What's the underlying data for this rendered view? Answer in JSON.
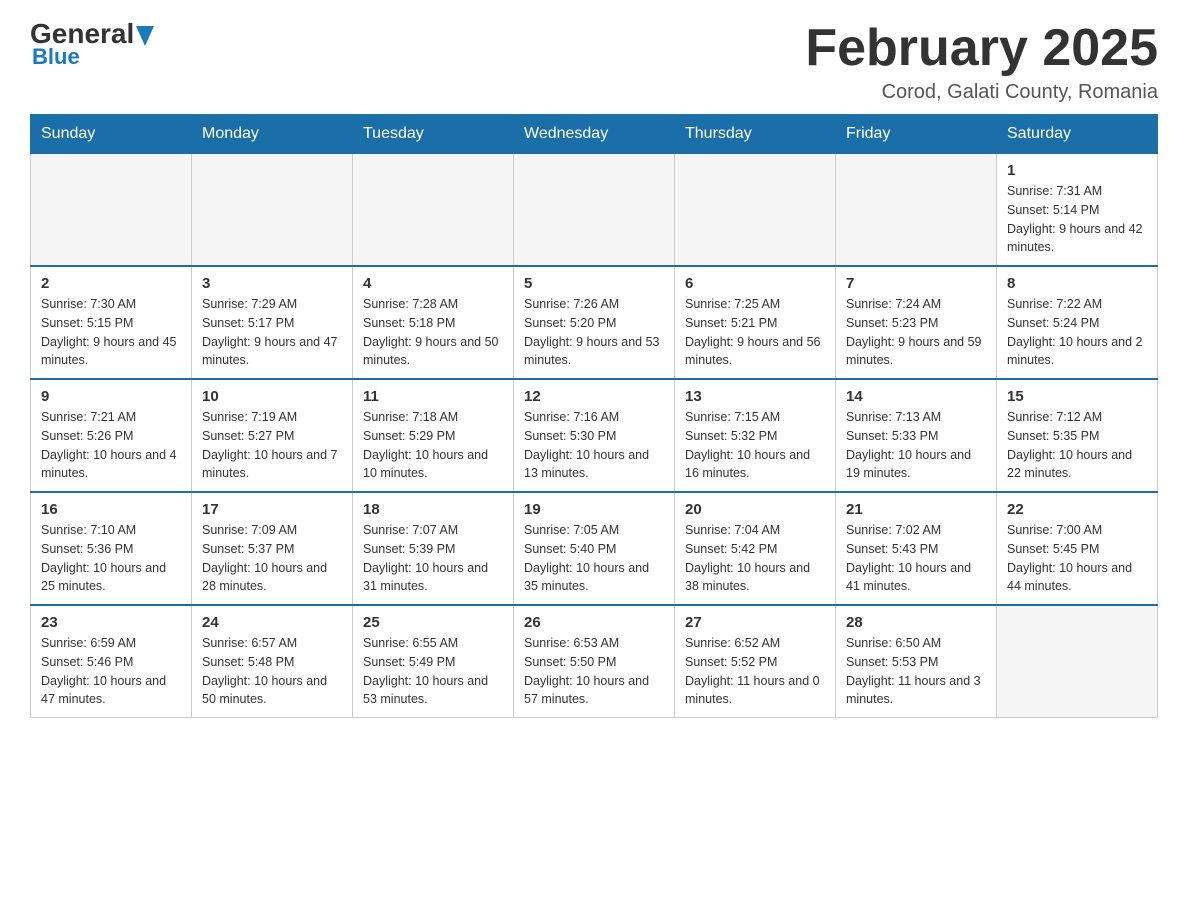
{
  "header": {
    "logo_general": "General",
    "logo_blue": "Blue",
    "month_title": "February 2025",
    "location": "Corod, Galati County, Romania"
  },
  "days_of_week": [
    "Sunday",
    "Monday",
    "Tuesday",
    "Wednesday",
    "Thursday",
    "Friday",
    "Saturday"
  ],
  "weeks": [
    [
      {
        "day": "",
        "info": ""
      },
      {
        "day": "",
        "info": ""
      },
      {
        "day": "",
        "info": ""
      },
      {
        "day": "",
        "info": ""
      },
      {
        "day": "",
        "info": ""
      },
      {
        "day": "",
        "info": ""
      },
      {
        "day": "1",
        "info": "Sunrise: 7:31 AM\nSunset: 5:14 PM\nDaylight: 9 hours and 42 minutes."
      }
    ],
    [
      {
        "day": "2",
        "info": "Sunrise: 7:30 AM\nSunset: 5:15 PM\nDaylight: 9 hours and 45 minutes."
      },
      {
        "day": "3",
        "info": "Sunrise: 7:29 AM\nSunset: 5:17 PM\nDaylight: 9 hours and 47 minutes."
      },
      {
        "day": "4",
        "info": "Sunrise: 7:28 AM\nSunset: 5:18 PM\nDaylight: 9 hours and 50 minutes."
      },
      {
        "day": "5",
        "info": "Sunrise: 7:26 AM\nSunset: 5:20 PM\nDaylight: 9 hours and 53 minutes."
      },
      {
        "day": "6",
        "info": "Sunrise: 7:25 AM\nSunset: 5:21 PM\nDaylight: 9 hours and 56 minutes."
      },
      {
        "day": "7",
        "info": "Sunrise: 7:24 AM\nSunset: 5:23 PM\nDaylight: 9 hours and 59 minutes."
      },
      {
        "day": "8",
        "info": "Sunrise: 7:22 AM\nSunset: 5:24 PM\nDaylight: 10 hours and 2 minutes."
      }
    ],
    [
      {
        "day": "9",
        "info": "Sunrise: 7:21 AM\nSunset: 5:26 PM\nDaylight: 10 hours and 4 minutes."
      },
      {
        "day": "10",
        "info": "Sunrise: 7:19 AM\nSunset: 5:27 PM\nDaylight: 10 hours and 7 minutes."
      },
      {
        "day": "11",
        "info": "Sunrise: 7:18 AM\nSunset: 5:29 PM\nDaylight: 10 hours and 10 minutes."
      },
      {
        "day": "12",
        "info": "Sunrise: 7:16 AM\nSunset: 5:30 PM\nDaylight: 10 hours and 13 minutes."
      },
      {
        "day": "13",
        "info": "Sunrise: 7:15 AM\nSunset: 5:32 PM\nDaylight: 10 hours and 16 minutes."
      },
      {
        "day": "14",
        "info": "Sunrise: 7:13 AM\nSunset: 5:33 PM\nDaylight: 10 hours and 19 minutes."
      },
      {
        "day": "15",
        "info": "Sunrise: 7:12 AM\nSunset: 5:35 PM\nDaylight: 10 hours and 22 minutes."
      }
    ],
    [
      {
        "day": "16",
        "info": "Sunrise: 7:10 AM\nSunset: 5:36 PM\nDaylight: 10 hours and 25 minutes."
      },
      {
        "day": "17",
        "info": "Sunrise: 7:09 AM\nSunset: 5:37 PM\nDaylight: 10 hours and 28 minutes."
      },
      {
        "day": "18",
        "info": "Sunrise: 7:07 AM\nSunset: 5:39 PM\nDaylight: 10 hours and 31 minutes."
      },
      {
        "day": "19",
        "info": "Sunrise: 7:05 AM\nSunset: 5:40 PM\nDaylight: 10 hours and 35 minutes."
      },
      {
        "day": "20",
        "info": "Sunrise: 7:04 AM\nSunset: 5:42 PM\nDaylight: 10 hours and 38 minutes."
      },
      {
        "day": "21",
        "info": "Sunrise: 7:02 AM\nSunset: 5:43 PM\nDaylight: 10 hours and 41 minutes."
      },
      {
        "day": "22",
        "info": "Sunrise: 7:00 AM\nSunset: 5:45 PM\nDaylight: 10 hours and 44 minutes."
      }
    ],
    [
      {
        "day": "23",
        "info": "Sunrise: 6:59 AM\nSunset: 5:46 PM\nDaylight: 10 hours and 47 minutes."
      },
      {
        "day": "24",
        "info": "Sunrise: 6:57 AM\nSunset: 5:48 PM\nDaylight: 10 hours and 50 minutes."
      },
      {
        "day": "25",
        "info": "Sunrise: 6:55 AM\nSunset: 5:49 PM\nDaylight: 10 hours and 53 minutes."
      },
      {
        "day": "26",
        "info": "Sunrise: 6:53 AM\nSunset: 5:50 PM\nDaylight: 10 hours and 57 minutes."
      },
      {
        "day": "27",
        "info": "Sunrise: 6:52 AM\nSunset: 5:52 PM\nDaylight: 11 hours and 0 minutes."
      },
      {
        "day": "28",
        "info": "Sunrise: 6:50 AM\nSunset: 5:53 PM\nDaylight: 11 hours and 3 minutes."
      },
      {
        "day": "",
        "info": ""
      }
    ]
  ]
}
